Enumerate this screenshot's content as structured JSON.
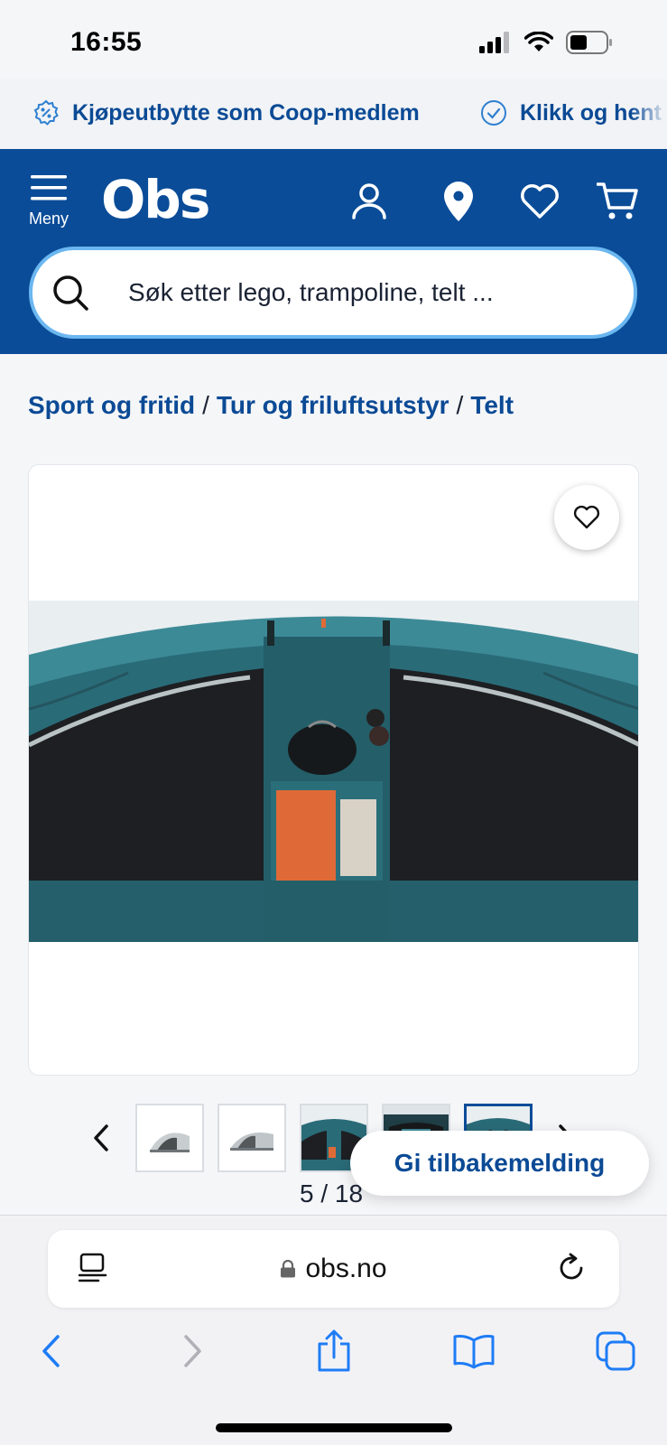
{
  "status": {
    "time": "16:55"
  },
  "promo": {
    "items": [
      {
        "icon": "percent-badge-icon",
        "text": "Kjøpeutbytte som Coop-medlem"
      },
      {
        "icon": "check-circle-icon",
        "text": "Klikk og hent"
      }
    ]
  },
  "header": {
    "menu_label": "Meny",
    "logo_text": "Obs",
    "brand_color": "#0a4c98"
  },
  "search": {
    "placeholder": "Søk etter lego, trampoline, telt ..."
  },
  "breadcrumb": {
    "items": [
      "Sport og fritid",
      "Tur og friluftsutstyr",
      "Telt"
    ],
    "separator": "/"
  },
  "gallery": {
    "current": 5,
    "total": 18,
    "counter_text": "5 / 18",
    "thumbnail_count": 5
  },
  "feedback": {
    "label": "Gi tilbakemelding"
  },
  "browser": {
    "url": "obs.no"
  }
}
